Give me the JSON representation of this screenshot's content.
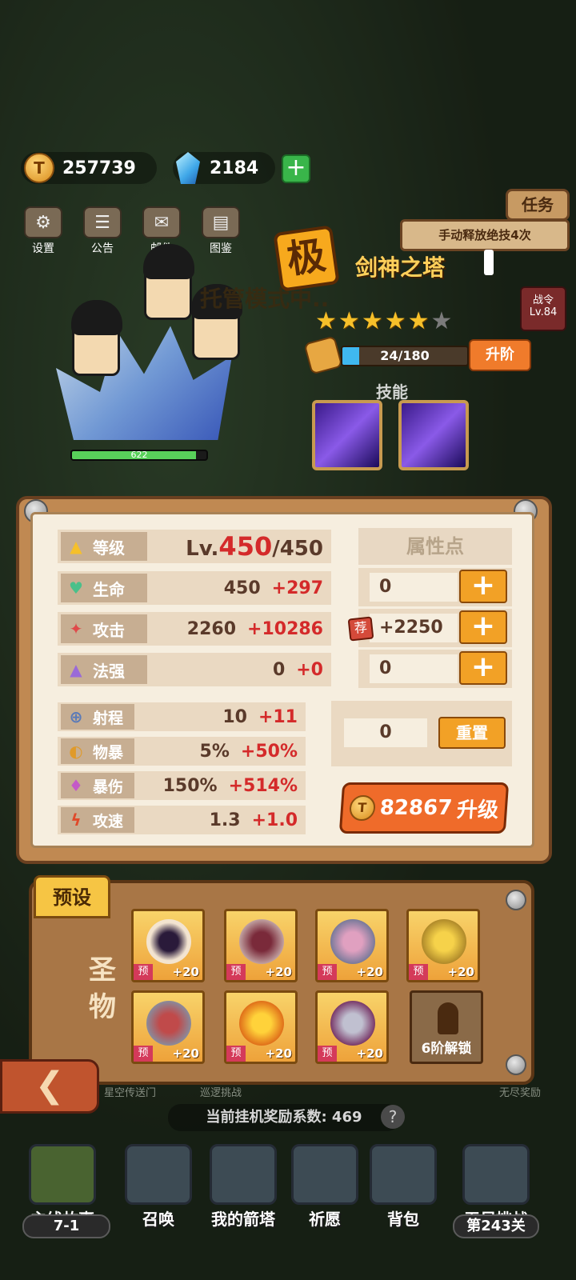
{
  "currency": {
    "gold": "257739",
    "gems": "2184"
  },
  "toolbar": {
    "items": [
      {
        "label": "设置"
      },
      {
        "label": "公告"
      },
      {
        "label": "邮件"
      },
      {
        "label": "图鉴"
      }
    ]
  },
  "task": {
    "title": "任务",
    "text": "手动释放绝技4次",
    "battle_pass_label": "战令",
    "battle_pass_level": "Lv.84"
  },
  "hero": {
    "grade": "极",
    "name": "剑神之塔",
    "mode_text": "托管模式中..",
    "stars_total": 6,
    "stars_filled": 5,
    "fragments": "24/180",
    "fragments_fraction": 0.133,
    "upgrade_label": "升阶",
    "skill_label": "技能",
    "hp_text": "622",
    "hp_fraction": 0.92
  },
  "stats": {
    "level": {
      "label": "等级",
      "prefix": "Lv.",
      "current": "450",
      "max": "/450"
    },
    "main": [
      {
        "label": "生命",
        "base": "450",
        "bonus": "+297"
      },
      {
        "label": "攻击",
        "base": "2260",
        "bonus": "+10286"
      },
      {
        "label": "法强",
        "base": "0",
        "bonus": "+0"
      }
    ],
    "secondary": [
      {
        "label": "射程",
        "base": "10",
        "bonus": "+11"
      },
      {
        "label": "物暴",
        "base": "5%",
        "bonus": "+50%"
      },
      {
        "label": "暴伤",
        "base": "150%",
        "bonus": "+514%"
      },
      {
        "label": "攻速",
        "base": "1.3",
        "bonus": "+1.0"
      }
    ]
  },
  "attributes": {
    "title": "属性点",
    "values": [
      "0",
      "+2250",
      "0"
    ],
    "recommend_label": "荐",
    "free_points": "0",
    "reset_label": "重置"
  },
  "levelup": {
    "cost": "82867",
    "label": "升级"
  },
  "relics": {
    "preset_label": "预设",
    "section_label": "圣物",
    "items": [
      {
        "pre": "预",
        "level": "+20"
      },
      {
        "pre": "预",
        "level": "+20"
      },
      {
        "pre": "预",
        "level": "+20"
      },
      {
        "pre": "预",
        "level": "+20"
      },
      {
        "pre": "预",
        "level": "+20"
      },
      {
        "pre": "预",
        "level": "+20"
      },
      {
        "pre": "预",
        "level": "+20"
      }
    ],
    "locked_label": "6阶解锁"
  },
  "idle": {
    "text": "当前挂机奖励系数: 469",
    "sub_left": "星空传送门",
    "sub_mid": "巡逻挑战",
    "sub_right": "无尽奖励"
  },
  "nav": {
    "items": [
      {
        "label": "主线故事"
      },
      {
        "label": "召唤"
      },
      {
        "label": "我的箭塔"
      },
      {
        "label": "祈愿"
      },
      {
        "label": "背包"
      },
      {
        "label": "无尽挑战"
      }
    ],
    "stage": "7-1",
    "endless_stage": "第243关"
  }
}
